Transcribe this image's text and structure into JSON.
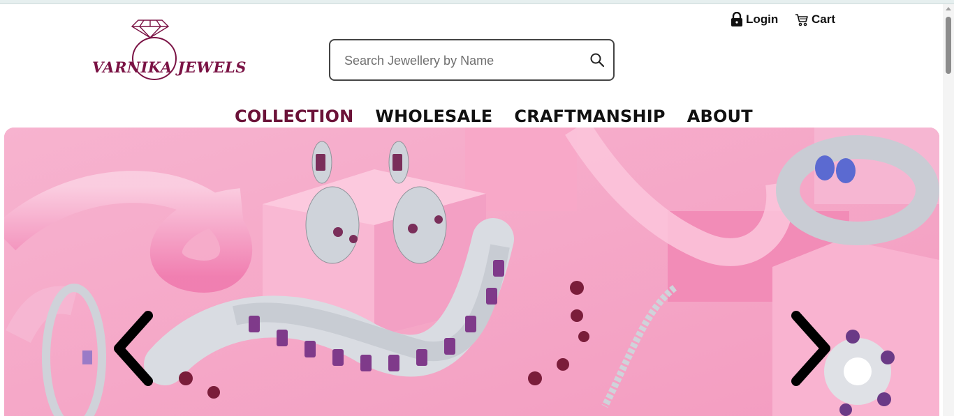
{
  "brand": {
    "name": "VARNIKA JEWELS",
    "accent_color": "#7a1244"
  },
  "search": {
    "placeholder": "Search Jewellery by Name",
    "icon": "search-icon"
  },
  "top_links": {
    "login": {
      "label": "Login",
      "icon": "lock-icon"
    },
    "cart": {
      "label": "Cart",
      "icon": "cart-icon"
    }
  },
  "nav": {
    "items": [
      {
        "label": "COLLECTION",
        "active": true
      },
      {
        "label": "WHOLESALE",
        "active": false
      },
      {
        "label": "CRAFTMANSHIP",
        "active": false
      },
      {
        "label": "ABOUT",
        "active": false
      }
    ],
    "active_color": "#6b1238"
  },
  "carousel": {
    "prev_icon": "chevron-left-icon",
    "next_icon": "chevron-right-icon",
    "background_color": "#f5a9c8"
  }
}
